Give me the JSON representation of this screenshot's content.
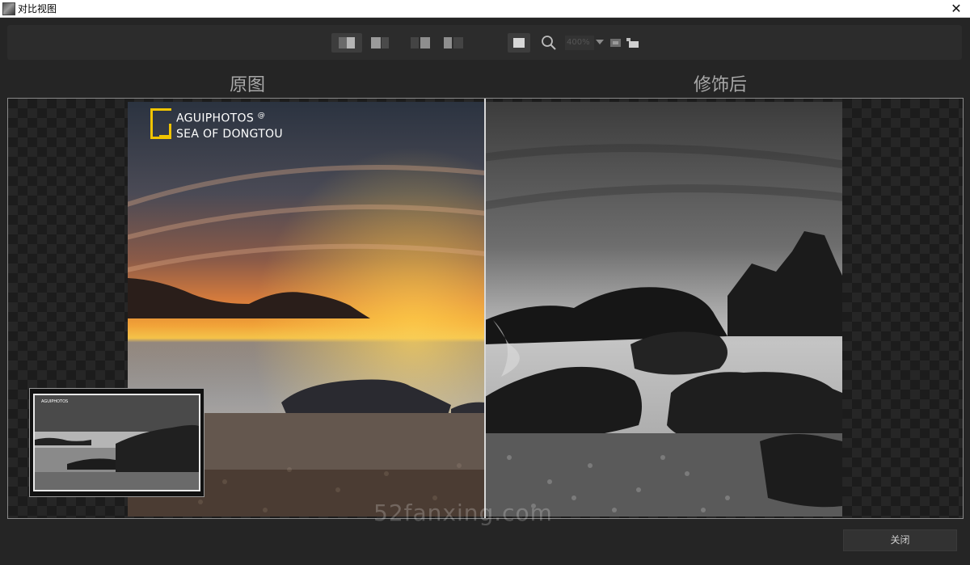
{
  "window": {
    "title": "对比视图",
    "close_glyph": "✕"
  },
  "toolbar": {
    "buttons": [
      {
        "icon": "split-view-icon",
        "active": true
      },
      {
        "icon": "side-by-side-icon",
        "active": false
      },
      {
        "icon": "left-compare-icon",
        "active": false
      },
      {
        "icon": "right-compare-icon",
        "active": false
      },
      {
        "icon": "single-view-icon",
        "active": true
      },
      {
        "icon": "zoom-icon",
        "active": false
      },
      {
        "icon": "fit-icon",
        "active": false
      },
      {
        "icon": "pan-icon",
        "active": false
      }
    ],
    "zoom_value": "400%"
  },
  "labels": {
    "before": "原图",
    "after": "修饰后"
  },
  "photo": {
    "watermark_line1": "AGUIPHOTOS",
    "watermark_at": "@",
    "watermark_line2": "SEA OF DONGTOU"
  },
  "overlay": {
    "site": "52fanxing.com"
  },
  "footer": {
    "close_label": "关闭"
  },
  "colors": {
    "accent": "#f0c400",
    "background": "#252525"
  }
}
